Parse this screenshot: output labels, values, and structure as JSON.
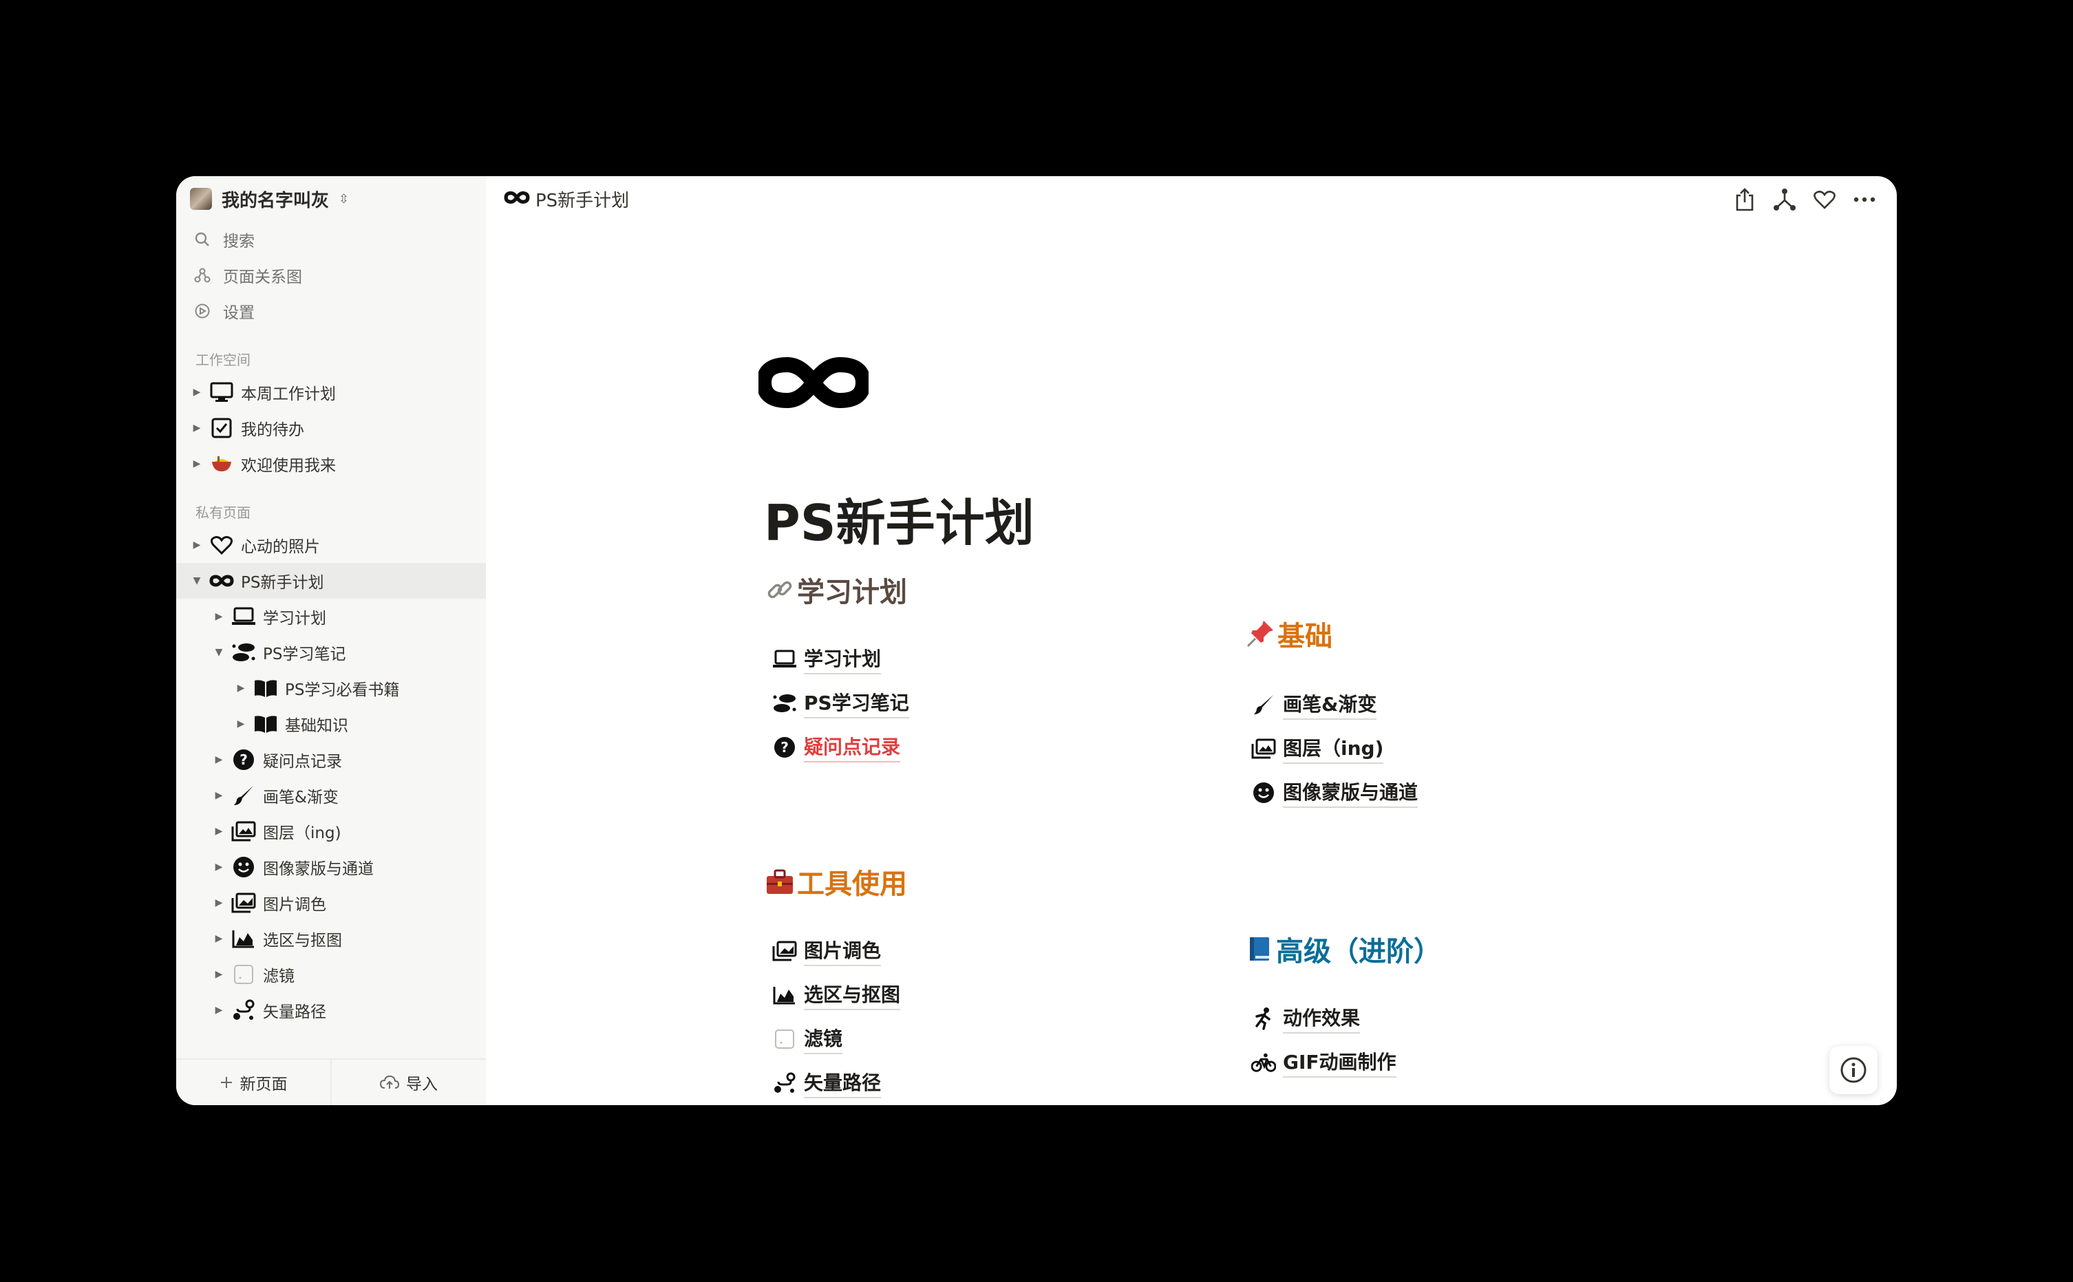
{
  "workspace": {
    "name": "我的名字叫灰"
  },
  "nav": [
    {
      "label": "搜索",
      "icon": "search-icon"
    },
    {
      "label": "页面关系图",
      "icon": "graph-icon"
    },
    {
      "label": "设置",
      "icon": "settings-icon"
    }
  ],
  "sections": {
    "workspace_title": "工作空间",
    "private_title": "私有页面"
  },
  "workspace_pages": [
    {
      "label": "本周工作计划",
      "icon": "desktop-icon"
    },
    {
      "label": "我的待办",
      "icon": "checkbox-icon"
    },
    {
      "label": "欢迎使用我来",
      "icon": "bowl-icon"
    }
  ],
  "private_pages": [
    {
      "label": "心动的照片",
      "icon": "heart-icon"
    },
    {
      "label": "PS新手计划",
      "icon": "infinity-icon"
    },
    {
      "label": "学习计划",
      "icon": "laptop-icon"
    },
    {
      "label": "PS学习笔记",
      "icon": "footprints-icon"
    },
    {
      "label": "PS学习必看书籍",
      "icon": "book-icon"
    },
    {
      "label": "基础知识",
      "icon": "book-icon"
    },
    {
      "label": "疑问点记录",
      "icon": "question-icon"
    },
    {
      "label": "画笔&渐变",
      "icon": "brush-icon"
    },
    {
      "label": "图层（ing)",
      "icon": "images-icon"
    },
    {
      "label": "图像蒙版与通道",
      "icon": "smile-icon"
    },
    {
      "label": "图片调色",
      "icon": "photo-icon"
    },
    {
      "label": "选区与抠图",
      "icon": "area-chart-icon"
    },
    {
      "label": "滤镜",
      "icon": "filter-icon"
    },
    {
      "label": "矢量路径",
      "icon": "route-icon"
    }
  ],
  "footer": {
    "new_page": "新页面",
    "import": "导入"
  },
  "breadcrumb": {
    "title": "PS新手计划"
  },
  "page": {
    "title": "PS新手计划",
    "sections": {
      "study": {
        "heading": "学习计划",
        "links": [
          {
            "label": "学习计划",
            "icon": "laptop-icon"
          },
          {
            "label": "PS学习笔记",
            "icon": "footprints-icon"
          },
          {
            "label": "疑问点记录",
            "icon": "question-icon"
          }
        ]
      },
      "basics": {
        "heading": "基础",
        "links": [
          {
            "label": "画笔&渐变",
            "icon": "brush-icon"
          },
          {
            "label": "图层（ing)",
            "icon": "images-icon"
          },
          {
            "label": "图像蒙版与通道",
            "icon": "smile-icon"
          }
        ]
      },
      "tools": {
        "heading": "工具使用",
        "links": [
          {
            "label": "图片调色",
            "icon": "photo-icon"
          },
          {
            "label": "选区与抠图",
            "icon": "area-chart-icon"
          },
          {
            "label": "滤镜",
            "icon": "filter-icon"
          },
          {
            "label": "矢量路径",
            "icon": "route-icon"
          }
        ]
      },
      "advanced": {
        "heading": "高级（进阶）",
        "links": [
          {
            "label": "动作效果",
            "icon": "running-icon"
          },
          {
            "label": "GIF动画制作",
            "icon": "bicycle-icon"
          }
        ]
      }
    }
  },
  "colors": {
    "study_heading": "#5a4a42",
    "basics_heading": "#d9730d",
    "tools_heading": "#d9730d",
    "advanced_heading": "#0b6e99",
    "link_red": "#e03e3e"
  }
}
